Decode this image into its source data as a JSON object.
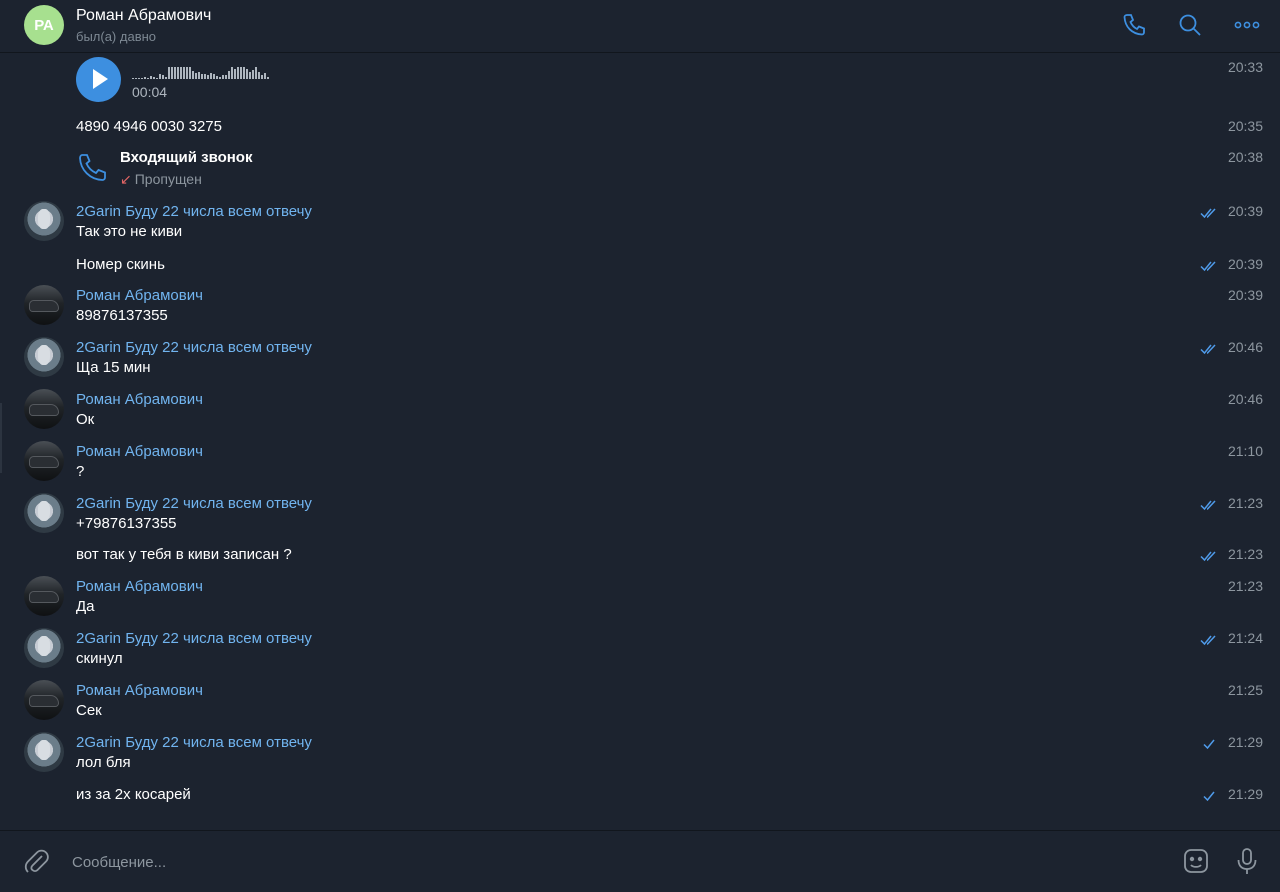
{
  "header": {
    "avatar_initials": "РА",
    "avatar_color": "#a7e08f",
    "name": "Роман Абрамович",
    "status": "был(а) давно",
    "icons": [
      "phone-icon",
      "search-icon",
      "more-icon"
    ]
  },
  "voice_message": {
    "duration": "00:04",
    "time": "20:33"
  },
  "card_message": {
    "text": "4890 4946 0030 3275",
    "time": "20:35"
  },
  "call_message": {
    "title": "Входящий звонок",
    "status": "Пропущен",
    "time": "20:38"
  },
  "messages": [
    {
      "sender": "2Garin Буду 22 числа всем отвечу",
      "text": "Так это не киви",
      "time": "20:39",
      "read": "double"
    },
    {
      "sender": "",
      "text": "Номер скинь",
      "time": "20:39",
      "read": "double"
    },
    {
      "sender": "Роман Абрамович",
      "text": "89876137355",
      "time": "20:39",
      "read": ""
    },
    {
      "sender": "2Garin Буду 22 числа всем отвечу",
      "text": "Ща 15 мин",
      "time": "20:46",
      "read": "double"
    },
    {
      "sender": "Роман Абрамович",
      "text": "Ок",
      "time": "20:46",
      "read": ""
    },
    {
      "sender": "Роман Абрамович",
      "text": "?",
      "time": "21:10",
      "read": ""
    },
    {
      "sender": "2Garin Буду 22 числа всем отвечу",
      "text": "+79876137355",
      "time": "21:23",
      "read": "double"
    },
    {
      "sender": "",
      "text": "вот так у тебя в киви записан ?",
      "time": "21:23",
      "read": "double"
    },
    {
      "sender": "Роман Абрамович",
      "text": "Да",
      "time": "21:23",
      "read": ""
    },
    {
      "sender": "2Garin Буду 22 числа всем отвечу",
      "text": "скинул",
      "time": "21:24",
      "read": "double"
    },
    {
      "sender": "Роман Абрамович",
      "text": "Сек",
      "time": "21:25",
      "read": ""
    },
    {
      "sender": "2Garin Буду 22 числа всем отвечу",
      "text": "лол бля",
      "time": "21:29",
      "read": "single"
    },
    {
      "sender": "",
      "text": "из за 2х косарей",
      "time": "21:29",
      "read": "single"
    }
  ],
  "composer": {
    "placeholder": "Сообщение..."
  },
  "colors": {
    "background": "#1c232f",
    "accent": "#3d8fe0",
    "sender": "#71b4ef",
    "missed": "#e26565"
  }
}
